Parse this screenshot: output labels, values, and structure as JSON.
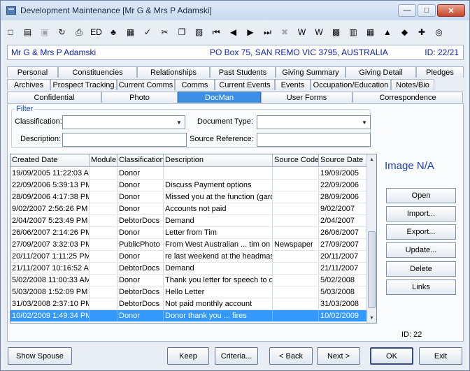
{
  "window": {
    "title": "Development Maintenance  [Mr G & Mrs P Adamski]",
    "min": "—",
    "max": "□",
    "close": "✕"
  },
  "toolbar": {
    "icons": [
      {
        "name": "new-icon",
        "glyph": "□",
        "grey": false
      },
      {
        "name": "open-folder-icon",
        "glyph": "▤",
        "grey": false
      },
      {
        "name": "save-icon",
        "glyph": "▣",
        "grey": true
      },
      {
        "name": "refresh-icon",
        "glyph": "↻",
        "grey": false
      },
      {
        "name": "print-icon",
        "glyph": "⎙",
        "grey": false
      },
      {
        "name": "edit-icon",
        "glyph": "ED",
        "grey": false
      },
      {
        "name": "tree-icon",
        "glyph": "♣",
        "grey": false
      },
      {
        "name": "calculator-icon",
        "glyph": "▦",
        "grey": false
      },
      {
        "name": "spellcheck-icon",
        "glyph": "✓",
        "grey": false
      },
      {
        "name": "cut-icon",
        "glyph": "✂",
        "grey": false
      },
      {
        "name": "copy-icon",
        "glyph": "❐",
        "grey": false
      },
      {
        "name": "paste-icon",
        "glyph": "▧",
        "grey": false
      },
      {
        "name": "first-record-icon",
        "glyph": "⏮",
        "grey": false
      },
      {
        "name": "previous-record-icon",
        "glyph": "◀",
        "grey": false
      },
      {
        "name": "next-record-icon",
        "glyph": "▶",
        "grey": false
      },
      {
        "name": "last-record-icon",
        "glyph": "⏭",
        "grey": false
      },
      {
        "name": "delete-icon",
        "glyph": "✖",
        "grey": true
      },
      {
        "name": "word-icon",
        "glyph": "W",
        "grey": false
      },
      {
        "name": "word-doc-icon",
        "glyph": "W",
        "grey": false
      },
      {
        "name": "excel-icon",
        "glyph": "▩",
        "grey": false
      },
      {
        "name": "clipboard-icon",
        "glyph": "▥",
        "grey": false
      },
      {
        "name": "calendar-icon",
        "glyph": "▦",
        "grey": false
      },
      {
        "name": "alert-icon",
        "glyph": "▲",
        "grey": false
      },
      {
        "name": "tag-icon",
        "glyph": "◆",
        "grey": false
      },
      {
        "name": "add-user-icon",
        "glyph": "✚",
        "grey": false
      },
      {
        "name": "preview-icon",
        "glyph": "◎",
        "grey": false
      }
    ]
  },
  "info": {
    "name": "Mr G & Mrs P Adamski",
    "address": "PO Box 75, SAN REMO VIC 3795, AUSTRALIA",
    "id": "ID: 22/21"
  },
  "tabs": {
    "row1": [
      "Personal",
      "Constituencies",
      "Relationships",
      "Past Students",
      "Giving Summary",
      "Giving Detail",
      "Pledges"
    ],
    "row2": [
      "Archives",
      "Prospect Tracking",
      "Current Comms",
      "Comms",
      "Current Events",
      "Events",
      "Occupation/Education",
      "Notes/Bio"
    ],
    "row3": [
      "Confidential",
      "Photo",
      "DocMan",
      "User Forms",
      "Correspondence"
    ],
    "active": "DocMan"
  },
  "filter": {
    "legend": "Filter",
    "classification_label": "Classification:",
    "classification_value": "",
    "doc_type_label": "Document Type:",
    "doc_type_value": "",
    "description_label": "Description:",
    "description_value": "",
    "source_ref_label": "Source Reference:",
    "source_ref_value": ""
  },
  "grid": {
    "columns": [
      "Created Date",
      "Module",
      "Classification",
      "Description",
      "Source Code",
      "Source Date"
    ],
    "rows": [
      [
        "19/09/2005 11:22:03 A",
        "",
        "Donor",
        "",
        "",
        "19/09/2005"
      ],
      [
        "22/09/2006 5:39:13 PM",
        "",
        "Donor",
        "Discuss Payment options",
        "",
        "22/09/2006"
      ],
      [
        "28/09/2006 4:17:38 PM",
        "",
        "Donor",
        "Missed you at the function (gard",
        "",
        "28/09/2006"
      ],
      [
        "9/02/2007 2:56:26 PM",
        "",
        "Donor",
        "Accounts not paid",
        "",
        "9/02/2007"
      ],
      [
        "2/04/2007 5:23:49 PM",
        "",
        "DebtorDocs",
        "Demand",
        "",
        "2/04/2007"
      ],
      [
        "26/06/2007 2:14:26 PM",
        "",
        "Donor",
        "Letter from Tim",
        "",
        "26/06/2007"
      ],
      [
        "27/09/2007 3:32:03 PM",
        "",
        "PublicPhoto",
        "From West Australian ... tim on",
        "Newspaper",
        "27/09/2007"
      ],
      [
        "20/11/2007 1:11:25 PM",
        "",
        "Donor",
        "re last weekend at the headmas",
        "",
        "20/11/2007"
      ],
      [
        "21/11/2007 10:16:52 A",
        "",
        "DebtorDocs",
        "Demand",
        "",
        "21/11/2007"
      ],
      [
        "5/02/2008 11:00:33 AM",
        "",
        "Donor",
        "Thank you letter for speech to d",
        "",
        "5/02/2008"
      ],
      [
        "5/03/2008 1:52:09 PM",
        "",
        "DebtorDocs",
        "Hello Letter",
        "",
        "5/03/2008"
      ],
      [
        "31/03/2008 2:37:10 PM",
        "",
        "DebtorDocs",
        "Not paid monthly account",
        "",
        "31/03/2008"
      ],
      [
        "10/02/2009 1:49:34 PM",
        "",
        "Donor",
        "Donor thank you ... fires",
        "",
        "10/02/2009"
      ]
    ],
    "selected_row": 12
  },
  "side": {
    "image_na": "Image N/A",
    "open": "Open",
    "import": "Import...",
    "export": "Export...",
    "update": "Update...",
    "delete": "Delete",
    "links": "Links",
    "id_label": "ID:  22"
  },
  "bottom": {
    "show_spouse": "Show Spouse",
    "keep": "Keep",
    "criteria": "Criteria...",
    "back": "< Back",
    "next": "Next >",
    "ok": "OK",
    "exit": "Exit"
  }
}
